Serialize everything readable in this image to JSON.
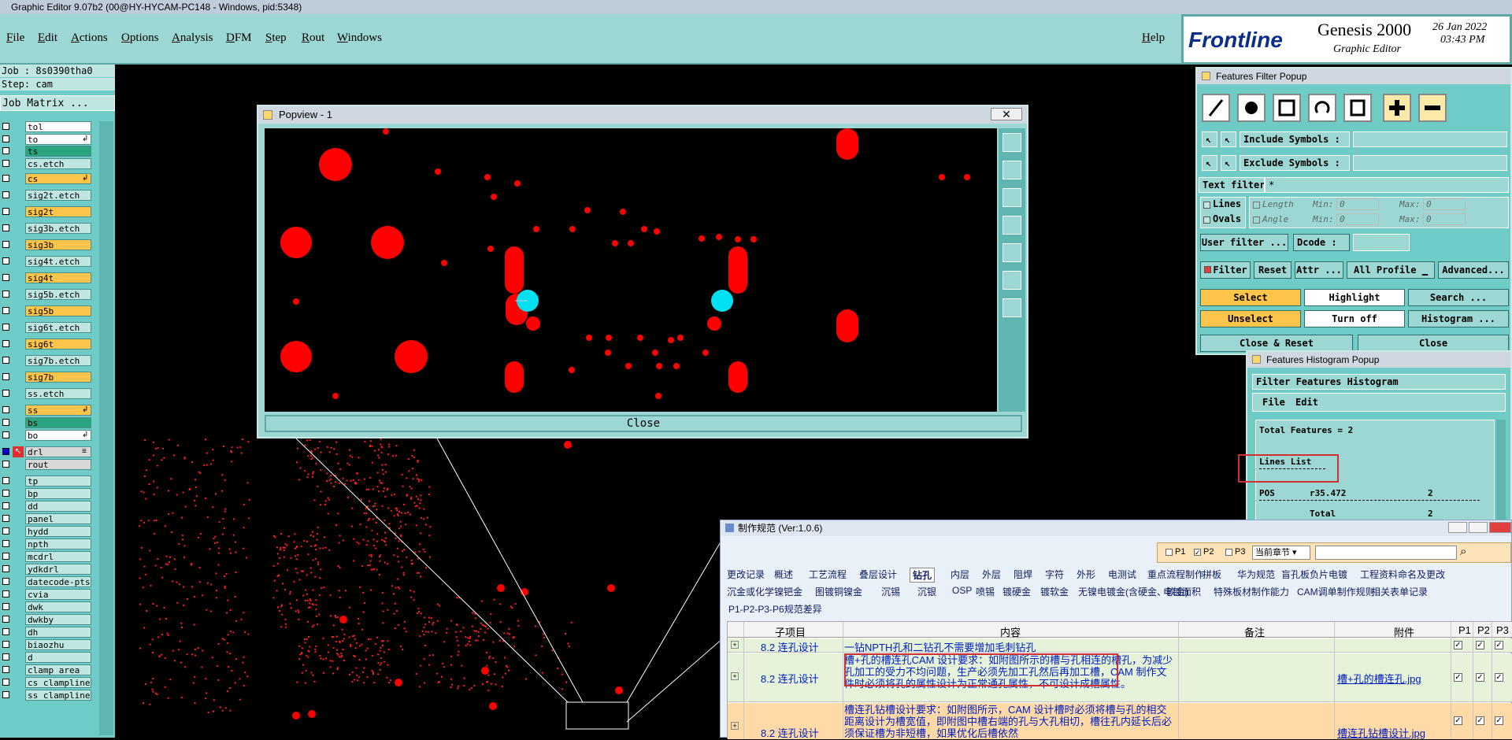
{
  "window": {
    "title": "Graphic Editor 9.07b2 (00@HY-HYCAM-PC148 - Windows, pid:5348)"
  },
  "menu": [
    "File",
    "Edit",
    "Actions",
    "Options",
    "Analysis",
    "DFM",
    "Step",
    "Rout",
    "Windows"
  ],
  "help": "Help",
  "logo": {
    "brand": "Frontline",
    "product": "Genesis 2000",
    "subtitle": "Graphic Editor",
    "date": "26 Jan 2022",
    "time": "03:43 PM"
  },
  "job": {
    "job": "Job : 8s0390tha0",
    "step": "Step: cam",
    "matrix": "Job Matrix ..."
  },
  "layers": [
    {
      "name": "tol",
      "bg": "#ffffff"
    },
    {
      "name": "to",
      "bg": "#ffffff",
      "mark": "↲"
    },
    {
      "name": "ts",
      "bg": "#2aa57f"
    },
    {
      "name": "cs.etch",
      "bg": "#bfe6e2"
    },
    {
      "name": "cs",
      "bg": "#ffc44a",
      "mark": "↲"
    },
    {
      "name": "sig2t.etch",
      "bg": "#bfe6e2"
    },
    {
      "name": "sig2t",
      "bg": "#ffc44a"
    },
    {
      "name": "sig3b.etch",
      "bg": "#bfe6e2"
    },
    {
      "name": "sig3b",
      "bg": "#ffc44a"
    },
    {
      "name": "sig4t.etch",
      "bg": "#bfe6e2"
    },
    {
      "name": "sig4t",
      "bg": "#ffc44a"
    },
    {
      "name": "sig5b.etch",
      "bg": "#bfe6e2"
    },
    {
      "name": "sig5b",
      "bg": "#ffc44a"
    },
    {
      "name": "sig6t.etch",
      "bg": "#bfe6e2"
    },
    {
      "name": "sig6t",
      "bg": "#ffc44a"
    },
    {
      "name": "sig7b.etch",
      "bg": "#bfe6e2"
    },
    {
      "name": "sig7b",
      "bg": "#ffc44a"
    },
    {
      "name": "ss.etch",
      "bg": "#bfe6e2"
    },
    {
      "name": "ss",
      "bg": "#ffc44a",
      "mark": "↲"
    },
    {
      "name": "bs",
      "bg": "#2aa57f"
    },
    {
      "name": "bo",
      "bg": "#ffffff",
      "mark": "↲"
    },
    {
      "name": "drl",
      "bg": "#d8d8d8",
      "mark": "≡",
      "active": true
    },
    {
      "name": "rout",
      "bg": "#d8d8d8"
    },
    {
      "name": "tp",
      "bg": "#bfe6e2"
    },
    {
      "name": "bp",
      "bg": "#bfe6e2"
    },
    {
      "name": "dd",
      "bg": "#bfe6e2"
    },
    {
      "name": "panel",
      "bg": "#bfe6e2"
    },
    {
      "name": "hydd",
      "bg": "#bfe6e2"
    },
    {
      "name": "npth",
      "bg": "#bfe6e2"
    },
    {
      "name": "mcdrl",
      "bg": "#bfe6e2"
    },
    {
      "name": "ydkdrl",
      "bg": "#bfe6e2"
    },
    {
      "name": "datecode-pts",
      "bg": "#bfe6e2"
    },
    {
      "name": "cvia",
      "bg": "#bfe6e2"
    },
    {
      "name": "dwk",
      "bg": "#bfe6e2"
    },
    {
      "name": "dwkby",
      "bg": "#bfe6e2"
    },
    {
      "name": "dh",
      "bg": "#bfe6e2"
    },
    {
      "name": "biaozhu",
      "bg": "#bfe6e2"
    },
    {
      "name": "d",
      "bg": "#bfe6e2"
    },
    {
      "name": "clamp_area",
      "bg": "#bfe6e2"
    },
    {
      "name": "cs_clampline",
      "bg": "#bfe6e2"
    },
    {
      "name": "ss_clampline",
      "bg": "#bfe6e2"
    }
  ],
  "popview": {
    "title": "Popview - 1",
    "close": "Close"
  },
  "filter": {
    "title": "Features Filter Popup",
    "include": "Include Symbols :",
    "exclude": "Exclude Symbols :",
    "text_filter": "Text filter",
    "text_filter_value": "*",
    "lines": "Lines",
    "ovals": "Ovals",
    "length": "Length",
    "angle": "Angle",
    "min": "Min:",
    "max": "Max:",
    "zero": "0",
    "user_filter": "User filter ...",
    "dcode": "Dcode :",
    "filter": "Filter",
    "reset": "Reset",
    "attr": "Attr ...",
    "all_profile": "All Profile",
    "advanced": "Advanced...",
    "select": "Select",
    "highlight": "Highlight",
    "search": "Search ...",
    "unselect": "Unselect",
    "turn_off": "Turn off",
    "histogram": "Histogram ...",
    "close_reset": "Close & Reset",
    "close": "Close"
  },
  "histogram": {
    "title": "Features Histogram Popup",
    "header": "Filter Features Histogram",
    "file": "File",
    "edit": "Edit",
    "total_features": "Total Features = 2",
    "lines_list": "Lines List",
    "row_label": "POS",
    "row_symbol": "r35.472",
    "row_count": "2",
    "total_label": "Total",
    "total_count": "2"
  },
  "spec": {
    "title": "制作规范 (Ver:1.0.6)",
    "p1": "P1",
    "p2": "P2",
    "p3": "P3",
    "scope": "当前章节",
    "tabs1": [
      "更改记录",
      "概述",
      "工艺流程",
      "叠层设计",
      "钻孔",
      "内层",
      "外层",
      "阻焊",
      "字符",
      "外形",
      "电测试",
      "重点流程制作",
      "拼板",
      "华为规范",
      "盲孔板负片电镀",
      "工程资料命名及更改"
    ],
    "tabs2": [
      "沉金或化学镍钯金",
      "图镀铜镍金",
      "沉锡",
      "沉银",
      "OSP",
      "喷锡",
      "镀硬金",
      "镀软金",
      "无镍电镀金(含硬金、软金)",
      "电镀面积",
      "特殊板材制作能力",
      "CAM调单制作规则",
      "相关表单记录"
    ],
    "tab3": "P1-P2-P3-P6规范差异",
    "headers": [
      "子项目",
      "内容",
      "备注",
      "附件",
      "P1",
      "P2",
      "P3"
    ],
    "rows": [
      {
        "sub": "8.2 连孔设计",
        "content": "一钻NPTH孔和二钻孔不需要增加毛刺钻孔",
        "note": "",
        "attach": ""
      },
      {
        "sub": "8.2 连孔设计",
        "content": "槽+孔的槽连孔CAM 设计要求：如附图所示的槽与孔相连的槽孔，为减少孔加工的受力不均问题，生产必须先加工孔然后再加工槽，CAM 制作文件时必须将孔的属性设计为正常通孔属性，不可设计成槽属性。",
        "note": "",
        "attach": "槽+孔的槽连孔.jpg"
      },
      {
        "sub": "8.2 连孔设计",
        "content": "槽连孔钻槽设计要求：如附图所示，CAM 设计槽时必须将槽与孔的相交距离设计为槽宽值，即附图中槽右端的孔与大孔相切，槽往孔内延长后必须保证槽为非短槽，如果优化后槽依然",
        "note": "",
        "attach": "槽连孔钻槽设计.jpg"
      }
    ]
  }
}
